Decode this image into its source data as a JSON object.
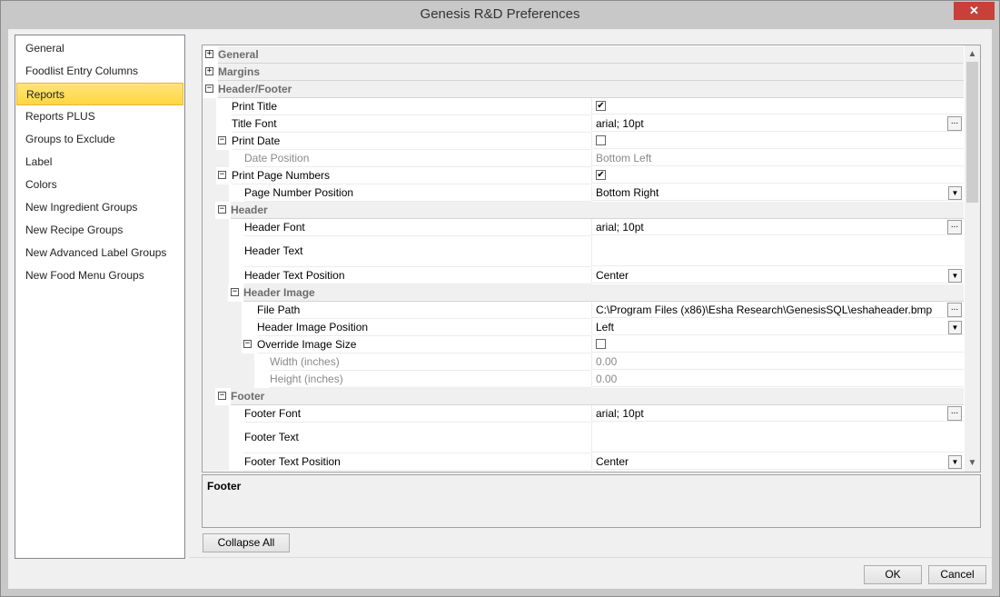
{
  "window": {
    "title": "Genesis R&D Preferences",
    "close_glyph": "✕"
  },
  "sidebar": {
    "items": [
      {
        "label": "General"
      },
      {
        "label": "Foodlist Entry Columns"
      },
      {
        "label": "Reports",
        "selected": true
      },
      {
        "label": "Reports PLUS"
      },
      {
        "label": "Groups to Exclude"
      },
      {
        "label": "Label"
      },
      {
        "label": "Colors"
      },
      {
        "label": "New Ingredient Groups"
      },
      {
        "label": "New Recipe Groups"
      },
      {
        "label": "New Advanced Label Groups"
      },
      {
        "label": "New Food Menu Groups"
      }
    ]
  },
  "grid": {
    "rows": [
      {
        "kind": "category",
        "depth": 0,
        "label": "General",
        "expander": "+"
      },
      {
        "kind": "category",
        "depth": 0,
        "label": "Margins",
        "expander": "+"
      },
      {
        "kind": "category",
        "depth": 0,
        "label": "Header/Footer",
        "expander": "−"
      },
      {
        "kind": "prop",
        "depth": 1,
        "label": "Print Title",
        "value": "",
        "editor": "check",
        "checked": true
      },
      {
        "kind": "prop",
        "depth": 1,
        "label": "Title Font",
        "value": "arial; 10pt",
        "editor": "ellipsis"
      },
      {
        "kind": "prop",
        "depth": 1,
        "label": "Print Date",
        "value": "",
        "editor": "check",
        "checked": false,
        "expander": "−"
      },
      {
        "kind": "prop",
        "depth": 2,
        "label": "Date Position",
        "value": "Bottom Left",
        "disabled": true
      },
      {
        "kind": "prop",
        "depth": 1,
        "label": "Print Page Numbers",
        "value": "",
        "editor": "check",
        "checked": true,
        "expander": "−"
      },
      {
        "kind": "prop",
        "depth": 2,
        "label": "Page Number Position",
        "value": "Bottom Right",
        "editor": "dropdown"
      },
      {
        "kind": "category",
        "depth": 1,
        "label": "Header",
        "expander": "−"
      },
      {
        "kind": "prop",
        "depth": 2,
        "label": "Header Font",
        "value": "arial; 10pt",
        "editor": "ellipsis"
      },
      {
        "kind": "prop",
        "depth": 2,
        "label": "Header Text",
        "value": "",
        "tall": true
      },
      {
        "kind": "prop",
        "depth": 2,
        "label": "Header Text Position",
        "value": "Center",
        "editor": "dropdown"
      },
      {
        "kind": "category",
        "depth": 2,
        "label": "Header Image",
        "expander": "−"
      },
      {
        "kind": "prop",
        "depth": 3,
        "label": "File Path",
        "value": "C:\\Program Files (x86)\\Esha Research\\GenesisSQL\\eshaheader.bmp",
        "editor": "ellipsis"
      },
      {
        "kind": "prop",
        "depth": 3,
        "label": "Header Image Position",
        "value": "Left",
        "editor": "dropdown"
      },
      {
        "kind": "prop",
        "depth": 3,
        "label": "Override Image Size",
        "value": "",
        "editor": "check",
        "checked": false,
        "expander": "−"
      },
      {
        "kind": "prop",
        "depth": 4,
        "label": "Width (inches)",
        "value": "0.00",
        "disabled": true
      },
      {
        "kind": "prop",
        "depth": 4,
        "label": "Height (inches)",
        "value": "0.00",
        "disabled": true
      },
      {
        "kind": "category",
        "depth": 1,
        "label": "Footer",
        "expander": "−"
      },
      {
        "kind": "prop",
        "depth": 2,
        "label": "Footer Font",
        "value": "arial; 10pt",
        "editor": "ellipsis"
      },
      {
        "kind": "prop",
        "depth": 2,
        "label": "Footer Text",
        "value": "",
        "tall": true
      },
      {
        "kind": "prop",
        "depth": 2,
        "label": "Footer Text Position",
        "value": "Center",
        "editor": "dropdown"
      }
    ]
  },
  "description": {
    "title": "Footer"
  },
  "buttons": {
    "collapse_all": "Collapse All",
    "ok": "OK",
    "cancel": "Cancel"
  },
  "glyphs": {
    "check": "✔",
    "ellipsis": "...",
    "dropdown": "▼",
    "scroll_up": "▲",
    "scroll_down": "▼"
  }
}
